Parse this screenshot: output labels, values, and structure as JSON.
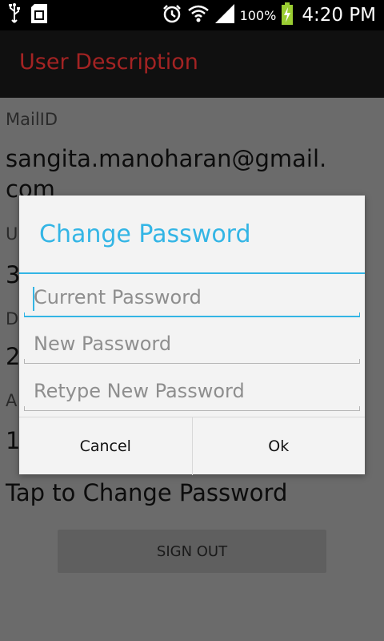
{
  "status_bar": {
    "icons": [
      "usb-icon",
      "sd-card-icon",
      "alarm-icon",
      "wifi-icon",
      "signal-icon",
      "battery-charging-icon"
    ],
    "battery": "100%",
    "time": "4:20 PM"
  },
  "app_bar": {
    "title": "User Description"
  },
  "profile": {
    "mail_label": "MailID",
    "mail_value_line1": "sangita.manoharan@gmail.",
    "mail_value_line2": "com",
    "row2_label": "U",
    "row2_value": "3",
    "row3_label": "D",
    "row3_value": "2",
    "row4_label": "A",
    "row4_value": "1",
    "tap_change": "Tap to Change Password",
    "sign_out": "SIGN OUT"
  },
  "dialog": {
    "title": "Change Password",
    "fields": [
      {
        "placeholder": "Current Password",
        "value": ""
      },
      {
        "placeholder": "New Password",
        "value": ""
      },
      {
        "placeholder": "Retype New Password",
        "value": ""
      }
    ],
    "cancel_label": "Cancel",
    "ok_label": "Ok"
  },
  "colors": {
    "accent": "#33b5e5",
    "title_red": "#a32323"
  }
}
